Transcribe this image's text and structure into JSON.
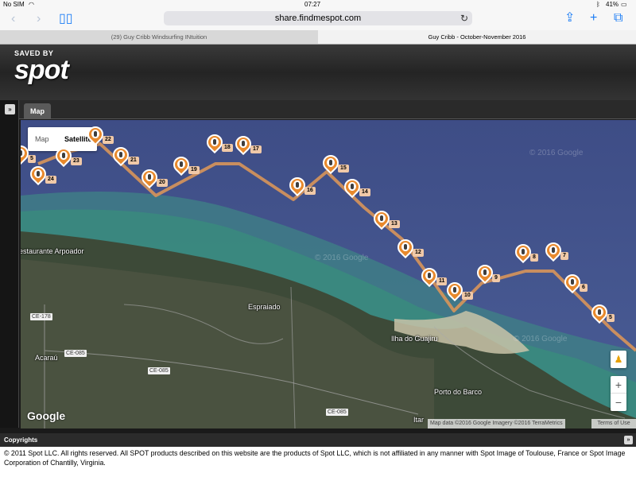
{
  "status": {
    "carrier": "No SIM",
    "wifi": "wifi-icon",
    "time": "07:27",
    "battery": "41%"
  },
  "browser": {
    "url": "share.findmespot.com",
    "tabs": [
      {
        "title": "(29) Guy Cribb Windsurfing INtuition"
      },
      {
        "title": "Guy Cribb - October-November 2016"
      }
    ]
  },
  "header": {
    "logo_top": "SAVED BY",
    "logo_main": "spot"
  },
  "map_tab": {
    "label": "Map"
  },
  "map_type": {
    "map": "Map",
    "satellite": "Satellite"
  },
  "markers": [
    {
      "num": "5"
    },
    {
      "num": "24"
    },
    {
      "num": "23"
    },
    {
      "num": "22"
    },
    {
      "num": "21"
    },
    {
      "num": "20"
    },
    {
      "num": "19"
    },
    {
      "num": "18"
    },
    {
      "num": "17"
    },
    {
      "num": "16"
    },
    {
      "num": "15"
    },
    {
      "num": "14"
    },
    {
      "num": "13"
    },
    {
      "num": "12"
    },
    {
      "num": "11"
    },
    {
      "num": "10"
    },
    {
      "num": "9"
    },
    {
      "num": "8"
    },
    {
      "num": "7"
    },
    {
      "num": "6"
    },
    {
      "num": "5"
    }
  ],
  "places": {
    "restaurant": "estaurante Arpoador",
    "espraiado": "Espraiado",
    "ilha": "Ilha do Guajiru",
    "acarau": "Acaraú",
    "porto": "Porto do Barco",
    "itar": "Itar"
  },
  "roads": {
    "ce178": "CE-178",
    "ce085a": "CE-085",
    "ce085b": "CE-085",
    "ce085c": "CE-085"
  },
  "watermarks": {
    "w1": "© 2016 Google",
    "w2": "© 2016 Google",
    "w3": "© 2016 Google"
  },
  "map_controls": {
    "zoom_in": "+",
    "zoom_out": "−"
  },
  "attribution": {
    "text": "Map data ©2016 Google Imagery ©2016 TerraMetrics",
    "terms": "Terms of Use",
    "google": "Google"
  },
  "copyrights": {
    "title": "Copyrights",
    "text": "© 2011 Spot LLC. All rights reserved. All SPOT products described on this website are the products of Spot LLC, which is not affiliated in any manner with Spot Image of Toulouse, France or Spot Image Corporation of Chantilly, Virginia."
  },
  "colors": {
    "marker": "#e8892c",
    "track": "#d8955a",
    "sea": "#4a5a8a",
    "land": "#3d4a38"
  }
}
